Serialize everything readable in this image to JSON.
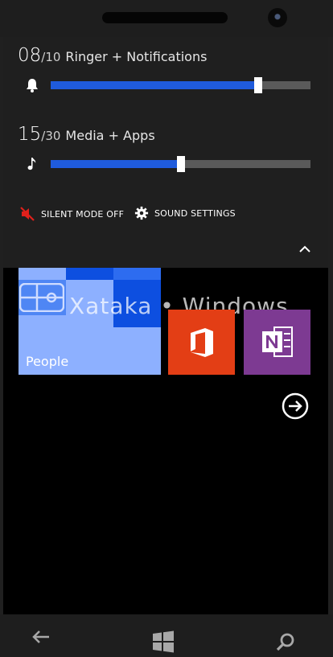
{
  "volume": {
    "ringer": {
      "level": "08",
      "max": "/10",
      "label": "Ringer + Notifications",
      "fraction": 0.8
    },
    "media": {
      "level": "15",
      "max": "/30",
      "label": "Media + Apps",
      "fraction": 0.5
    },
    "silent_mode_label": "SILENT MODE OFF",
    "sound_settings_label": "SOUND SETTINGS"
  },
  "tiles": {
    "people": "People"
  },
  "watermark": "Xataka • Windows",
  "colors": {
    "accent": "#1f5bdc",
    "people_tile": "#8db0ff",
    "office_tile": "#e33e15",
    "onenote_tile": "#7d3a92",
    "silent_icon": "#e0201b"
  },
  "icons": [
    "bell-icon",
    "music-note-icon",
    "speaker-muted-icon",
    "gear-icon",
    "chevron-up-icon",
    "office-icon",
    "onenote-icon",
    "arrow-right-circle-icon",
    "back-arrow-icon",
    "windows-logo-icon",
    "search-icon"
  ]
}
